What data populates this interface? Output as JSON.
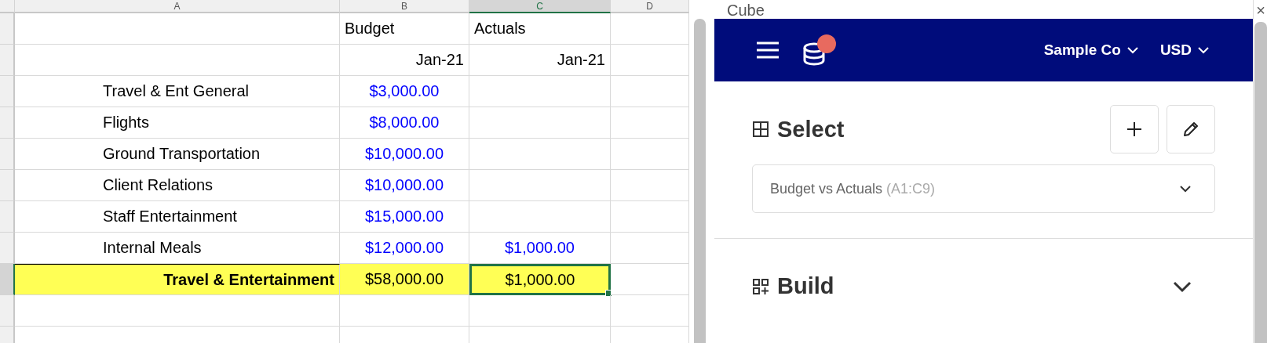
{
  "spreadsheet": {
    "columns": [
      {
        "label": "A",
        "selected": false
      },
      {
        "label": "B",
        "selected": false
      },
      {
        "label": "C",
        "selected": true
      },
      {
        "label": "D",
        "selected": false
      }
    ],
    "rows": [
      {
        "kind": "heading",
        "selected": false,
        "budget": "Budget",
        "actuals": "Actuals"
      },
      {
        "kind": "period",
        "selected": false,
        "budget": "Jan-21",
        "actuals": "Jan-21"
      },
      {
        "kind": "input",
        "selected": false,
        "label": "Travel & Ent General",
        "budget": "$3,000.00"
      },
      {
        "kind": "input",
        "selected": false,
        "label": "Flights",
        "budget": "$8,000.00"
      },
      {
        "kind": "input",
        "selected": false,
        "label": "Ground Transportation",
        "budget": "$10,000.00"
      },
      {
        "kind": "input",
        "selected": false,
        "label": "Client Relations",
        "budget": "$10,000.00"
      },
      {
        "kind": "input",
        "selected": false,
        "label": "Staff Entertainment",
        "budget": "$15,000.00"
      },
      {
        "kind": "input",
        "selected": false,
        "label": "Internal Meals",
        "budget": "$12,000.00",
        "actuals": "$1,000.00"
      },
      {
        "kind": "total",
        "selected": true,
        "label": "Travel & Entertainment",
        "budget": "$58,000.00",
        "actuals": "$1,000.00"
      },
      {
        "kind": "blank",
        "selected": false
      },
      {
        "kind": "blank",
        "selected": false
      }
    ]
  },
  "panel": {
    "title": "Cube",
    "close": "×",
    "nav": {
      "has_notification": true,
      "company": "Sample Co",
      "currency": "USD"
    },
    "select": {
      "heading": "Select",
      "value": "Budget vs Actuals",
      "range": "(A1:C9)"
    },
    "build": {
      "heading": "Build",
      "expanded": false
    }
  }
}
